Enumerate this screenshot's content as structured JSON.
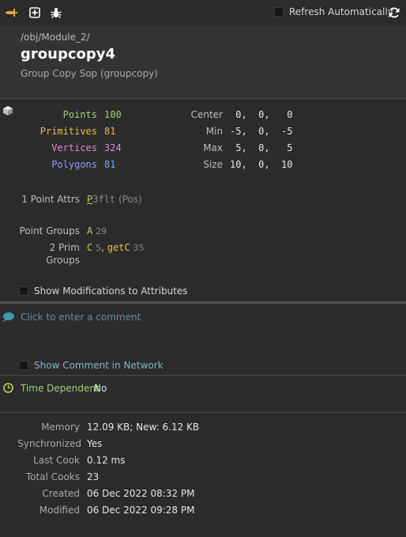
{
  "toolbar": {
    "icons": [
      "pin-icon",
      "plus-icon",
      "bug-icon",
      "refresh-icon"
    ],
    "refresh_label": "Refresh Automatically"
  },
  "header": {
    "path": "/obj/Module_2/",
    "node_name": "groupcopy4",
    "node_type": "Group Copy Sop (groupcopy)"
  },
  "geometry": {
    "counts": [
      {
        "label": "Points",
        "value": "100",
        "color": "#9fd07a"
      },
      {
        "label": "Primitives",
        "value": "81",
        "color": "#e7c04b"
      },
      {
        "label": "Vertices",
        "value": "324",
        "color": "#e08ad0"
      },
      {
        "label": "Polygons",
        "value": "81",
        "color": "#8e9ff5"
      }
    ],
    "bbox": [
      {
        "label": "Center",
        "value": " 0,  0,   0"
      },
      {
        "label": "Min",
        "value": "-5,  0,  -5"
      },
      {
        "label": "Max",
        "value": " 5,  0,   5"
      },
      {
        "label": "Size",
        "value": "10,  0,  10"
      }
    ]
  },
  "attributes": {
    "point_attrs_label": "1 Point Attrs",
    "point_attr_name": "P",
    "point_attr_type": "3flt",
    "point_attr_note": "(Pos)",
    "point_groups_label": "Point Groups",
    "point_group_name": "A",
    "point_group_count": "29",
    "prim_groups_label_1": "2 Prim",
    "prim_groups_label_2": "Groups",
    "prim_group_1_name": "C",
    "prim_group_1_count": "5",
    "prim_group_sep": ",",
    "prim_group_2_name": "getC",
    "prim_group_2_count": "35"
  },
  "show_modifications_label": "Show Modifications to Attributes",
  "comment": {
    "placeholder": "Click to enter a comment",
    "show_in_network_label": "Show Comment in Network"
  },
  "time_dependent": {
    "label": "Time Dependent",
    "value": "No"
  },
  "info": [
    {
      "label": "Memory",
      "value": "12.09 KB; New: 6.12 KB"
    },
    {
      "label": "Synchronized",
      "value": "Yes"
    },
    {
      "label": "Last Cook",
      "value": "0.12 ms"
    },
    {
      "label": "Total Cooks",
      "value": "23"
    },
    {
      "label": "Created",
      "value": "06 Dec 2022 08:32 PM"
    },
    {
      "label": "Modified",
      "value": "06 Dec 2022 09:28 PM"
    }
  ],
  "colors": {
    "green": "#9fd07a",
    "yellow": "#e7c04b",
    "pink": "#e08ad0",
    "blue": "#8e9ff5",
    "comment_blue": "#5f8f9b"
  }
}
